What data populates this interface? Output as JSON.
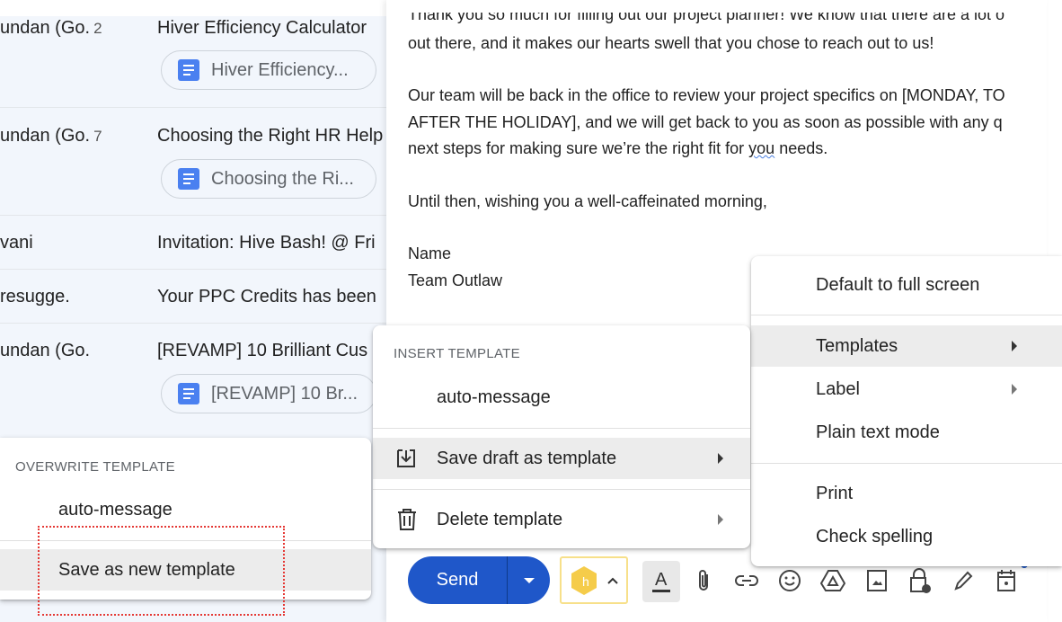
{
  "inbox": {
    "rows": [
      {
        "sender": "undan (Go.",
        "count": "2",
        "subject": "Hiver Efficiency Calculator",
        "attachment": "Hiver Efficiency..."
      },
      {
        "sender": "undan (Go.",
        "count": "7",
        "subject": "Choosing the Right HR Help",
        "attachment": "Choosing the Ri..."
      },
      {
        "sender": "vani",
        "subject": "Invitation: Hive Bash! @ Fri"
      },
      {
        "sender": "resugge.",
        "subject": "Your PPC Credits has been"
      },
      {
        "sender": "undan (Go.",
        "subject": "[REVAMP] 10 Brilliant Cus",
        "attachment": "[REVAMP] 10 Br..."
      }
    ]
  },
  "compose": {
    "lines": [
      "Thank you so much for filling out our project planner! We know that there are a lot o",
      "out there, and it makes our hearts swell that you chose to reach out to us!",
      "Our team will be back in the office to review your project specifics on [MONDAY, TO",
      "AFTER THE HOLIDAY], and we will get back to you as soon as possible with any q",
      "next steps for making sure we’re the right fit for ",
      "you",
      " needs.",
      "Until then, wishing you a well-caffeinated morning,",
      "Name",
      "Team Outlaw"
    ],
    "send_label": "Send"
  },
  "more_menu": {
    "items": [
      "Default to full screen",
      "Templates",
      "Label",
      "Plain text mode",
      "Print",
      "Check spelling"
    ]
  },
  "templates_menu": {
    "header": "INSERT TEMPLATE",
    "items": [
      "auto-message",
      "Save draft as template",
      "Delete template"
    ]
  },
  "save_menu": {
    "header": "OVERWRITE TEMPLATE",
    "items": [
      "auto-message",
      "Save as new template"
    ]
  },
  "colors": {
    "send": "#1f57c9",
    "highlight_box": "#e53935",
    "hiver": "#f5cc4a"
  }
}
